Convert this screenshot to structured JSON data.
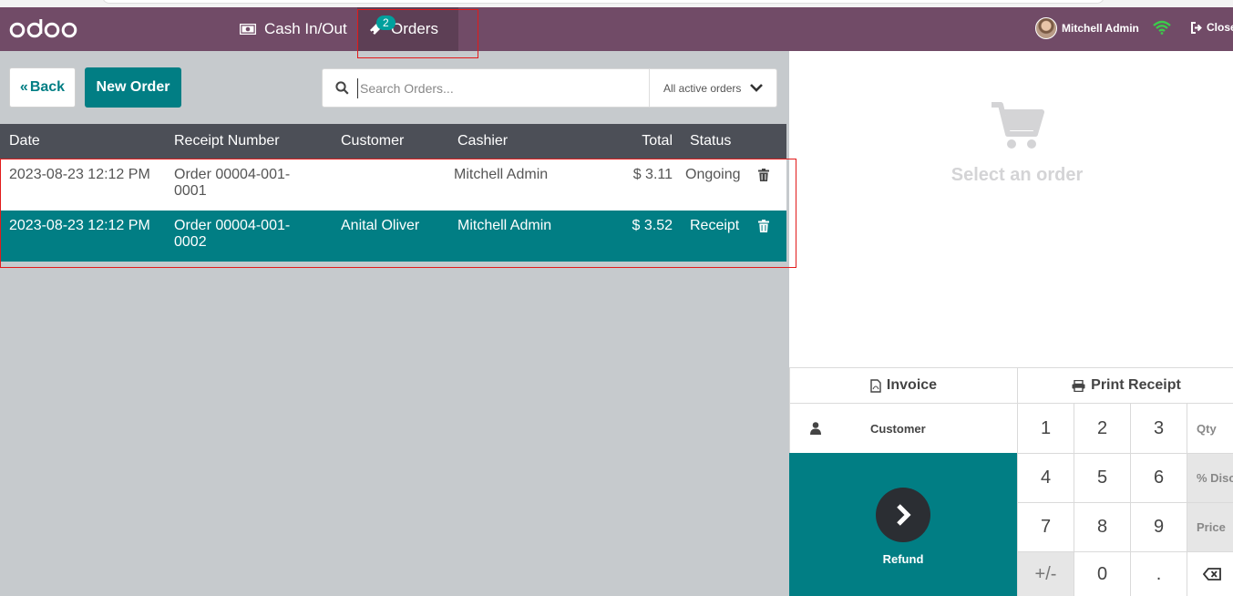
{
  "app": {
    "logo_text": "odoo"
  },
  "topbar": {
    "cash_label": "Cash In/Out",
    "orders_label": "Orders",
    "orders_badge": "2",
    "user_name": "Mitchell Admin",
    "close_label": "Close"
  },
  "toolbar": {
    "back_label": "Back",
    "new_order_label": "New Order",
    "search_placeholder": "Search Orders...",
    "filter_label": "All active orders"
  },
  "table": {
    "headers": {
      "date": "Date",
      "receipt": "Receipt Number",
      "customer": "Customer",
      "cashier": "Cashier",
      "total": "Total",
      "status": "Status"
    },
    "rows": [
      {
        "date": "2023-08-23 12:12 PM",
        "receipt_line1": "Order 00004-001-",
        "receipt_line2": "0001",
        "customer": "",
        "cashier": "Mitchell Admin",
        "total": "$ 3.11",
        "status": "Ongoing"
      },
      {
        "date": "2023-08-23 12:12 PM",
        "receipt_line1": "Order 00004-001-",
        "receipt_line2": "0002",
        "customer": "Anital Oliver",
        "cashier": "Mitchell Admin",
        "total": "$ 3.52",
        "status": "Receipt"
      }
    ]
  },
  "detail": {
    "empty_message": "Select an order"
  },
  "controls": {
    "invoice_label": "Invoice",
    "print_label": "Print Receipt",
    "customer_label": "Customer",
    "refund_label": "Refund",
    "keys": [
      "1",
      "2",
      "3",
      "4",
      "5",
      "6",
      "7",
      "8",
      "9",
      "+/-",
      "0",
      "."
    ],
    "modes": [
      "Qty",
      "% Disc",
      "Price"
    ]
  },
  "colors": {
    "brand": "#714b67",
    "accent": "#017e84",
    "highlight": "#e21b1b"
  }
}
